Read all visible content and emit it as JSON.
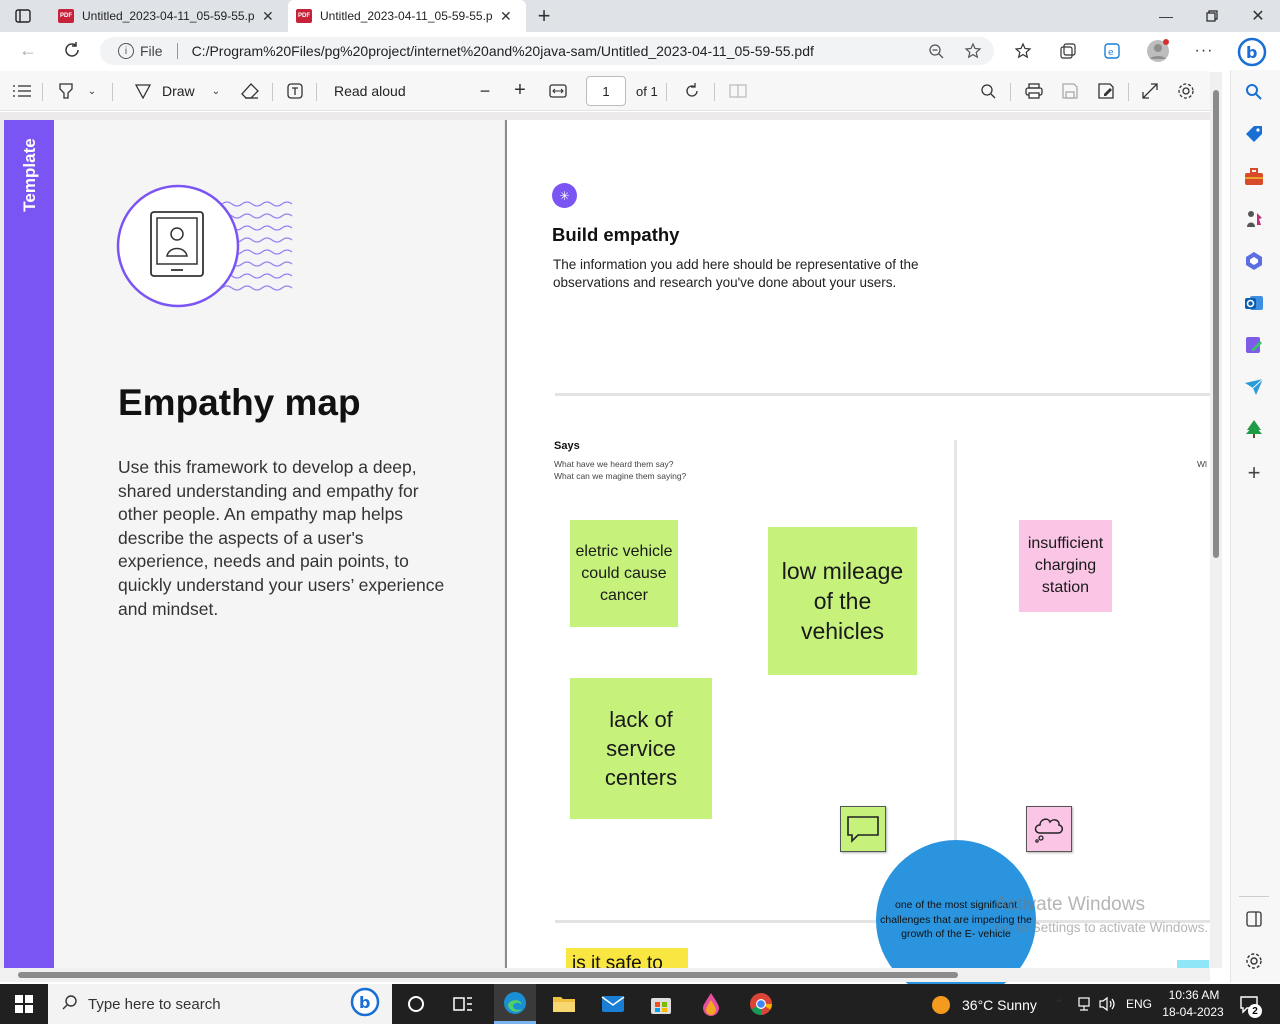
{
  "browser": {
    "tabs": [
      {
        "title": "Untitled_2023-04-11_05-59-55.p",
        "active": false
      },
      {
        "title": "Untitled_2023-04-11_05-59-55.p",
        "active": true
      }
    ],
    "address": {
      "label": "File",
      "url": "C:/Program%20Files/pg%20project/internet%20and%20java-sam/Untitled_2023-04-11_05-59-55.pdf"
    }
  },
  "pdf_toolbar": {
    "draw_label": "Draw",
    "read_aloud_label": "Read aloud",
    "page_number": "1",
    "page_count": "of 1"
  },
  "left_page": {
    "side_tab": "Template",
    "title": "Empathy map",
    "description": "Use this framework to develop a deep, shared understanding and empathy for other people. An empathy map helps describe the aspects of a user's experience, needs and pain points, to quickly understand your users’ experience and mindset."
  },
  "right_page": {
    "heading": "Build empathy",
    "intro": "The information you add here should be representative of the observations and research you've done about your users.",
    "section_title": "Says",
    "section_q1": "What have we heard them say?",
    "section_q2": "What can we magine them saying?",
    "cut_label": "Wl",
    "stickies": [
      {
        "text": "eletric vehicle could cause cancer"
      },
      {
        "text": "low mileage of the vehicles"
      },
      {
        "text": "insufficient charging station"
      },
      {
        "text": "lack of service centers"
      },
      {
        "text": "is it safe to"
      }
    ],
    "circle_note": "one of the most significant challenges that are impeding the growth of the E- vehicle",
    "watermark_title": "Activate Windows",
    "watermark_sub": "Go to Settings to activate Windows."
  },
  "taskbar": {
    "search_placeholder": "Type here to search",
    "weather": "36°C  Sunny",
    "language": "ENG",
    "time": "10:36 AM",
    "date": "18-04-2023",
    "notification_count": "2"
  },
  "colors": {
    "accent_purple": "#7b55f3",
    "sticky_green": "#c6f27b",
    "sticky_pink": "#fbc6e6",
    "sticky_yellow": "#f9e640",
    "circle_blue": "#2a94de",
    "pdf_red": "#c6223a"
  }
}
